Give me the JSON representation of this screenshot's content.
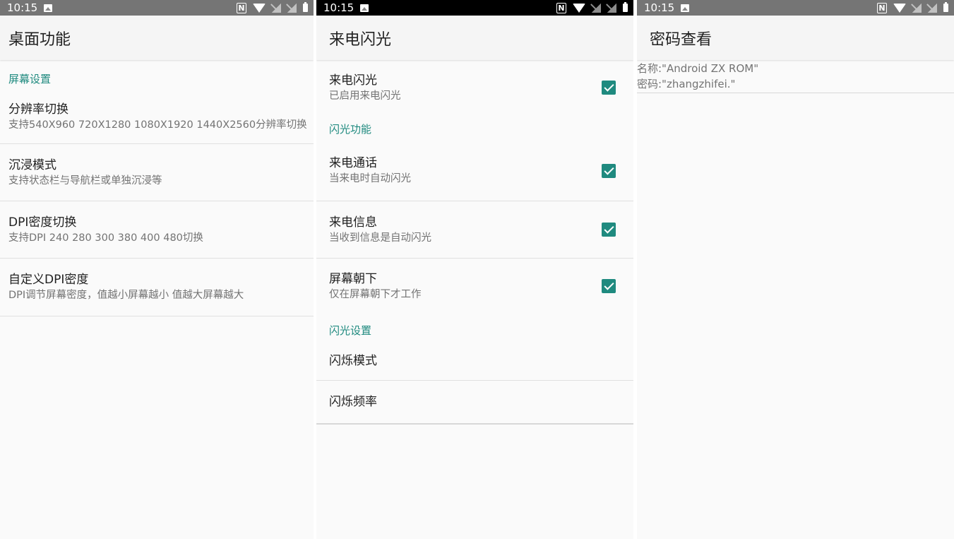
{
  "status_time": "10:15",
  "panel1": {
    "title": "桌面功能",
    "category": "屏幕设置",
    "items": [
      {
        "title": "分辨率切换",
        "summary": "支持540X960 720X1280 1080X1920 1440X2560分辨率切换"
      },
      {
        "title": "沉浸模式",
        "summary": "支持状态栏与导航栏或单独沉浸等"
      },
      {
        "title": "DPI密度切换",
        "summary": "支持DPI 240 280 300 380 400 480切换"
      },
      {
        "title": "自定义DPI密度",
        "summary": "DPI调节屏幕密度，值越小屏幕越小 值越大屏幕越大"
      }
    ]
  },
  "panel2": {
    "title": "来电闪光",
    "main_item": {
      "title": "来电闪光",
      "summary": "已启用来电闪光",
      "checked": true
    },
    "category_function": "闪光功能",
    "function_items": [
      {
        "title": "来电通话",
        "summary": "当来电时自动闪光",
        "checked": true
      },
      {
        "title": "来电信息",
        "summary": "当收到信息是自动闪光",
        "checked": true
      },
      {
        "title": "屏幕朝下",
        "summary": "仅在屏幕朝下才工作",
        "checked": true
      }
    ],
    "category_settings": "闪光设置",
    "settings_items": [
      {
        "title": "闪烁模式"
      },
      {
        "title": "闪烁频率"
      }
    ]
  },
  "panel3": {
    "title": "密码查看",
    "name_line": "名称:\"Android ZX ROM\"",
    "password_line": "密码:\"zhangzhifei.\""
  },
  "colors": {
    "accent": "#1f8a7f",
    "status_gray": "#757575",
    "status_black": "#000000"
  },
  "icons": [
    "image-icon",
    "nfc-icon",
    "wifi-icon",
    "signal-icon",
    "battery-icon",
    "checkbox-checked-icon"
  ]
}
